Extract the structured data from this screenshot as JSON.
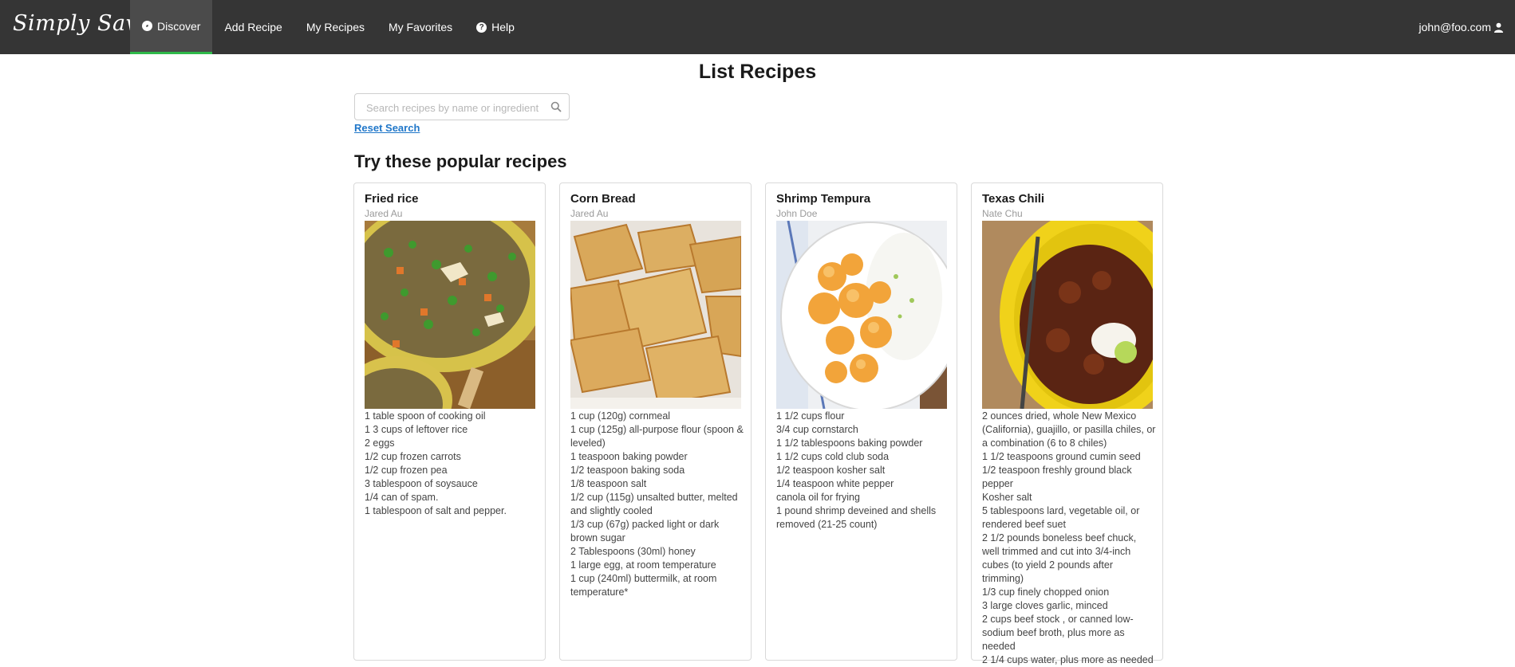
{
  "brand": "Simply Savory",
  "nav": {
    "items": [
      {
        "label": "Discover",
        "icon": "compass-icon",
        "active": true
      },
      {
        "label": "Add Recipe"
      },
      {
        "label": "My Recipes"
      },
      {
        "label": "My Favorites"
      },
      {
        "label": "Help",
        "icon": "question-circle-icon"
      }
    ]
  },
  "user": {
    "email": "john@foo.com",
    "icon": "user-icon"
  },
  "page": {
    "title": "List Recipes"
  },
  "search": {
    "placeholder": "Search recipes by name or ingredient",
    "value": "",
    "reset_label": "Reset Search"
  },
  "popular": {
    "title": "Try these popular recipes"
  },
  "recipes": [
    {
      "title": "Fried rice",
      "author": "Jared Au",
      "image": "fried-rice-photo",
      "ingredients": [
        "1 table spoon of cooking oil",
        "1 3 cups of leftover rice",
        "2 eggs",
        "1/2 cup frozen carrots",
        "1/2 cup frozen pea",
        "3 tablespoon of soysauce",
        "1/4 can of spam.",
        "1 tablespoon of salt and pepper."
      ]
    },
    {
      "title": "Corn Bread",
      "author": "Jared Au",
      "image": "corn-bread-photo",
      "ingredients": [
        "1 cup (120g) cornmeal",
        "1 cup (125g) all-purpose flour (spoon & leveled)",
        "1 teaspoon baking powder",
        "1/2 teaspoon baking soda",
        "1/8 teaspoon salt",
        "1/2 cup (115g) unsalted butter, melted and slightly cooled",
        "1/3 cup (67g) packed light or dark brown sugar",
        "2 Tablespoons (30ml) honey",
        "1 large egg, at room temperature",
        "1 cup (240ml) buttermilk, at room temperature*"
      ]
    },
    {
      "title": "Shrimp Tempura",
      "author": "John Doe",
      "image": "shrimp-tempura-photo",
      "ingredients": [
        "1 1/2 cups flour",
        "3/4 cup cornstarch",
        "1 1/2 tablespoons baking powder",
        "1 1/2 cups cold club soda",
        "1/2 teaspoon kosher salt",
        "1/4 teaspoon white pepper",
        "canola oil for frying",
        "1 pound shrimp deveined and shells removed (21-25 count)"
      ]
    },
    {
      "title": "Texas Chili",
      "author": "Nate Chu",
      "image": "texas-chili-photo",
      "ingredients": [
        "2 ounces dried, whole New Mexico (California), guajillo, or pasilla chiles, or a combination (6 to 8 chiles)",
        "1 1/2 teaspoons ground cumin seed",
        "1/2 teaspoon freshly ground black pepper",
        "Kosher salt",
        "5 tablespoons lard, vegetable oil, or rendered beef suet",
        "2 1/2 pounds boneless beef chuck, well trimmed and cut into 3/4-inch cubes (to yield 2 pounds after trimming)",
        "1/3 cup finely chopped onion",
        "3 large cloves garlic, minced",
        "2 cups beef stock , or canned low-sodium beef broth, plus more as needed",
        "2 1/4 cups water, plus more as needed"
      ]
    }
  ],
  "colors": {
    "navbar": "#353535",
    "active_underline": "#2fb94a",
    "link": "#2077c9"
  }
}
